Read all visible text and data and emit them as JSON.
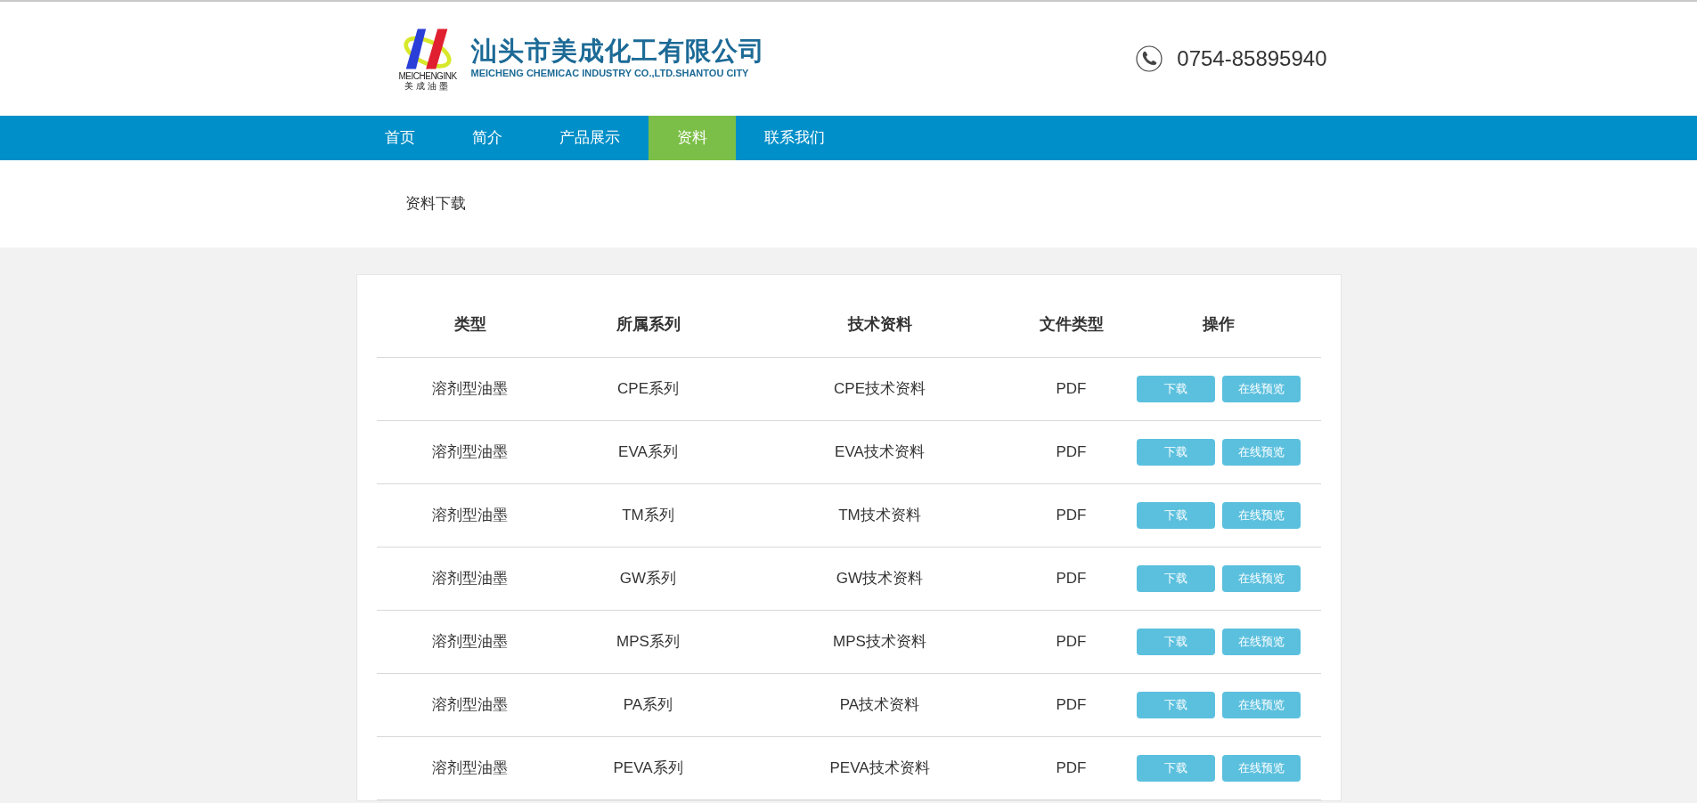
{
  "header": {
    "logo_caption": "MEICHENGINK",
    "logo_subcaption": "美成油墨",
    "company_name": "汕头市美成化工有限公司",
    "company_name_en": "MEICHENG CHEMICAC INDUSTRY CO.,LTD.SHANTOU CITY",
    "phone": "0754-85895940"
  },
  "nav": [
    {
      "label": "首页",
      "selected": false
    },
    {
      "label": "简介",
      "selected": false
    },
    {
      "label": "产品展示",
      "selected": false
    },
    {
      "label": "资料",
      "selected": true
    },
    {
      "label": "联系我们",
      "selected": false
    }
  ],
  "breadcrumb": "资料下载",
  "table": {
    "columns": [
      "类型",
      "所属系列",
      "技术资料",
      "文件类型",
      "操作"
    ],
    "rows": [
      {
        "type": "溶剂型油墨",
        "series": "CPE系列",
        "document": "CPE技术资料",
        "file_type": "PDF",
        "actions": [
          "下载",
          "在线预览"
        ]
      },
      {
        "type": "溶剂型油墨",
        "series": "EVA系列",
        "document": "EVA技术资料",
        "file_type": "PDF",
        "actions": [
          "下载",
          "在线预览"
        ]
      },
      {
        "type": "溶剂型油墨",
        "series": "TM系列",
        "document": "TM技术资料",
        "file_type": "PDF",
        "actions": [
          "下载",
          "在线预览"
        ]
      },
      {
        "type": "溶剂型油墨",
        "series": "GW系列",
        "document": "GW技术资料",
        "file_type": "PDF",
        "actions": [
          "下载",
          "在线预览"
        ]
      },
      {
        "type": "溶剂型油墨",
        "series": "MPS系列",
        "document": "MPS技术资料",
        "file_type": "PDF",
        "actions": [
          "下载",
          "在线预览"
        ]
      },
      {
        "type": "溶剂型油墨",
        "series": "PA系列",
        "document": "PA技术资料",
        "file_type": "PDF",
        "actions": [
          "下载",
          "在线预览"
        ]
      },
      {
        "type": "溶剂型油墨",
        "series": "PEVA系列",
        "document": "PEVA技术资料",
        "file_type": "PDF",
        "actions": [
          "下载",
          "在线预览"
        ]
      }
    ]
  }
}
